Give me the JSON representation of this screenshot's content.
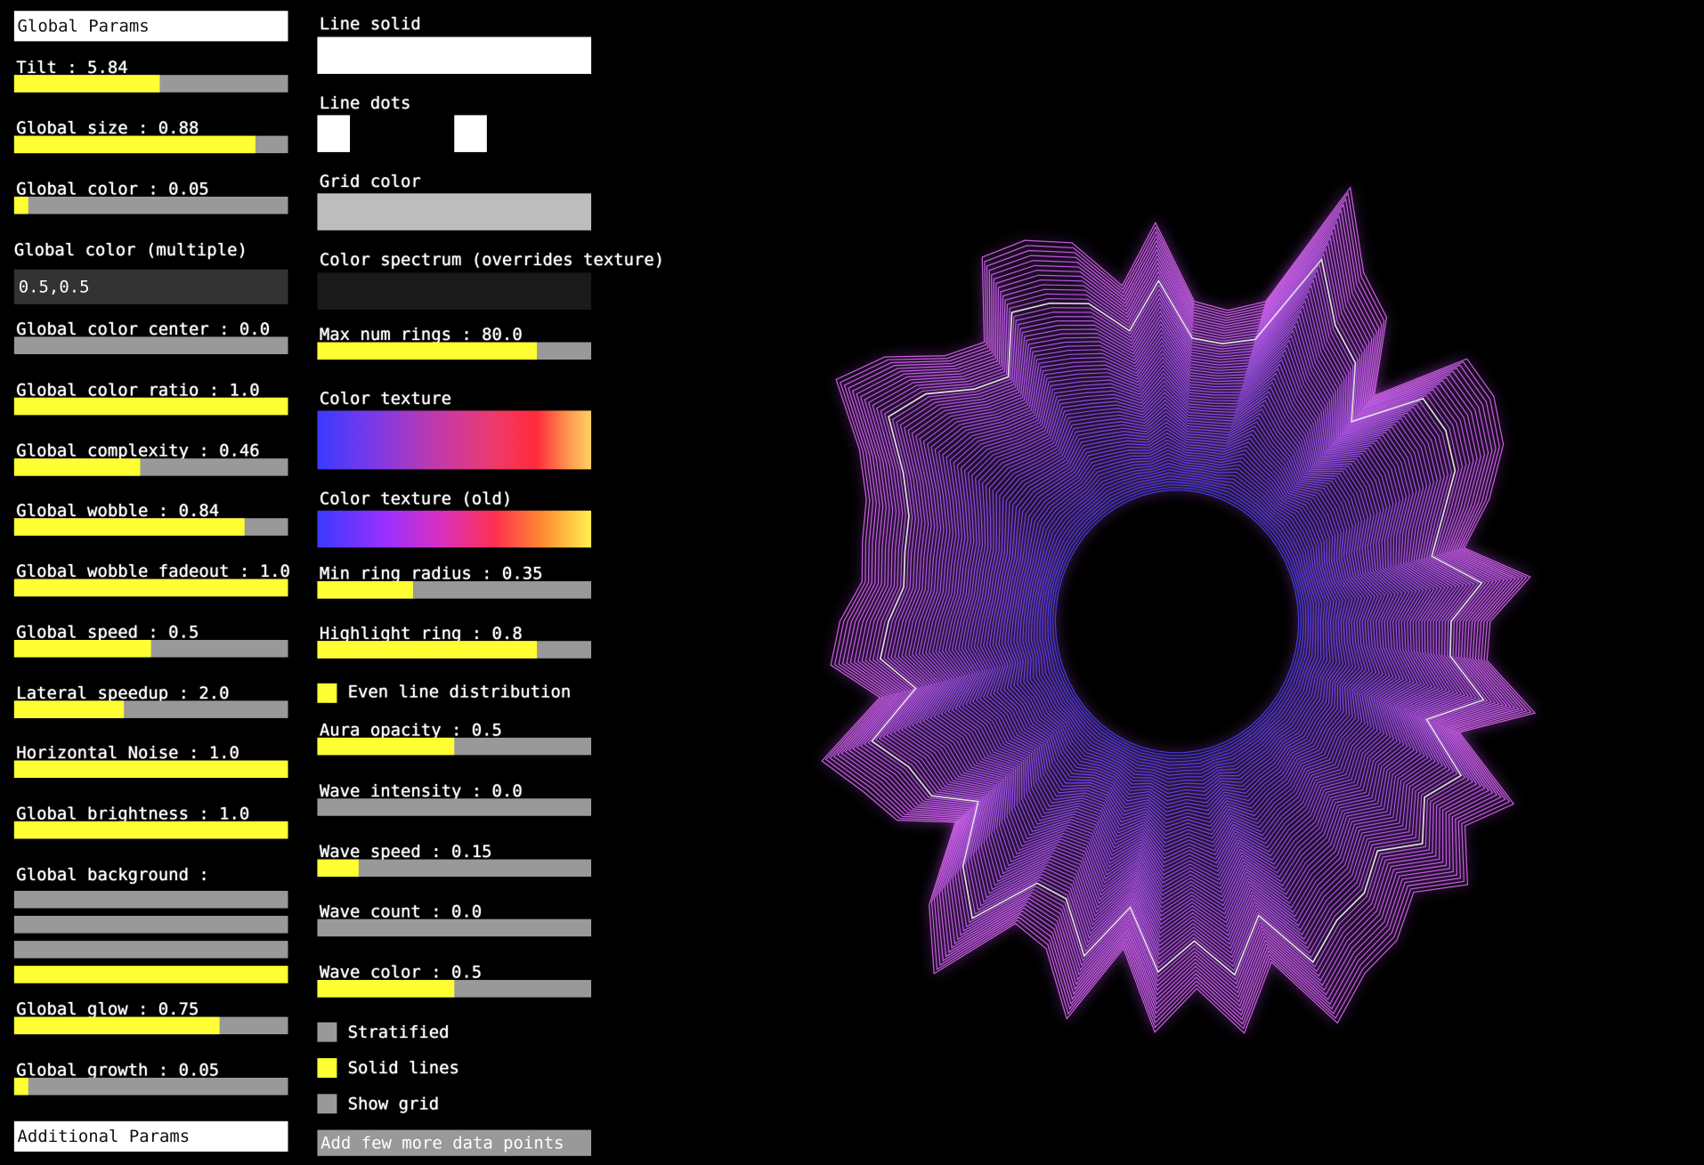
{
  "left": {
    "header": "Global Params",
    "sliders": [
      {
        "label": "Tilt : 5.84",
        "fill": 0.53
      },
      {
        "label": "Global size : 0.88",
        "fill": 0.88
      },
      {
        "label": "Global color : 0.05",
        "fill": 0.05
      }
    ],
    "multi_color": {
      "label": "Global color (multiple)",
      "value": "0.5,0.5"
    },
    "sliders2": [
      {
        "label": "Global color center : 0.0",
        "fill": 0.0
      },
      {
        "label": "Global color ratio : 1.0",
        "fill": 1.0
      },
      {
        "label": "Global complexity : 0.46",
        "fill": 0.46
      },
      {
        "label": "Global wobble : 0.84",
        "fill": 0.84
      },
      {
        "label": "Global wobble fadeout : 1.0",
        "fill": 1.0
      },
      {
        "label": "Global speed : 0.5",
        "fill": 0.5
      },
      {
        "label": "Lateral speedup : 2.0",
        "fill": 0.4
      },
      {
        "label": "Horizontal Noise : 1.0",
        "fill": 1.0
      },
      {
        "label": "Global brightness : 1.0",
        "fill": 1.0
      }
    ],
    "background": {
      "label": "Global background :",
      "channels": [
        0,
        0,
        0,
        1
      ]
    },
    "sliders3": [
      {
        "label": "Global glow : 0.75",
        "fill": 0.75
      },
      {
        "label": "Global growth : 0.05",
        "fill": 0.05
      }
    ],
    "footer": "Additional Params"
  },
  "right": {
    "line_solid": "Line solid",
    "line_dots": "Line dots",
    "grid_color": "Grid color",
    "color_spectrum": "Color spectrum (overrides texture)",
    "max_rings": {
      "label": "Max num rings : 80.0",
      "fill": 0.8
    },
    "color_texture": "Color texture",
    "color_texture_old": "Color texture (old)",
    "sliders": [
      {
        "label": "Min ring radius : 0.35",
        "fill": 0.35
      },
      {
        "label": "Highlight ring : 0.8",
        "fill": 0.8
      }
    ],
    "even_lines": {
      "label": "Even line distribution",
      "checked": true
    },
    "sliders2": [
      {
        "label": "Aura opacity : 0.5",
        "fill": 0.5
      },
      {
        "label": "Wave intensity : 0.0",
        "fill": 0.0
      },
      {
        "label": "Wave speed : 0.15",
        "fill": 0.15
      },
      {
        "label": "Wave count : 0.0",
        "fill": 0.0
      },
      {
        "label": "Wave color : 0.5",
        "fill": 0.5
      }
    ],
    "checkboxes": [
      {
        "label": "Stratified",
        "checked": false
      },
      {
        "label": "Solid lines",
        "checked": true
      },
      {
        "label": "Show grid",
        "checked": false
      }
    ],
    "button": "Add few more data points"
  },
  "colors": {
    "accent": "#ffff33",
    "track": "#999999",
    "inner": "#4444ff",
    "outer": "#e070ff"
  }
}
